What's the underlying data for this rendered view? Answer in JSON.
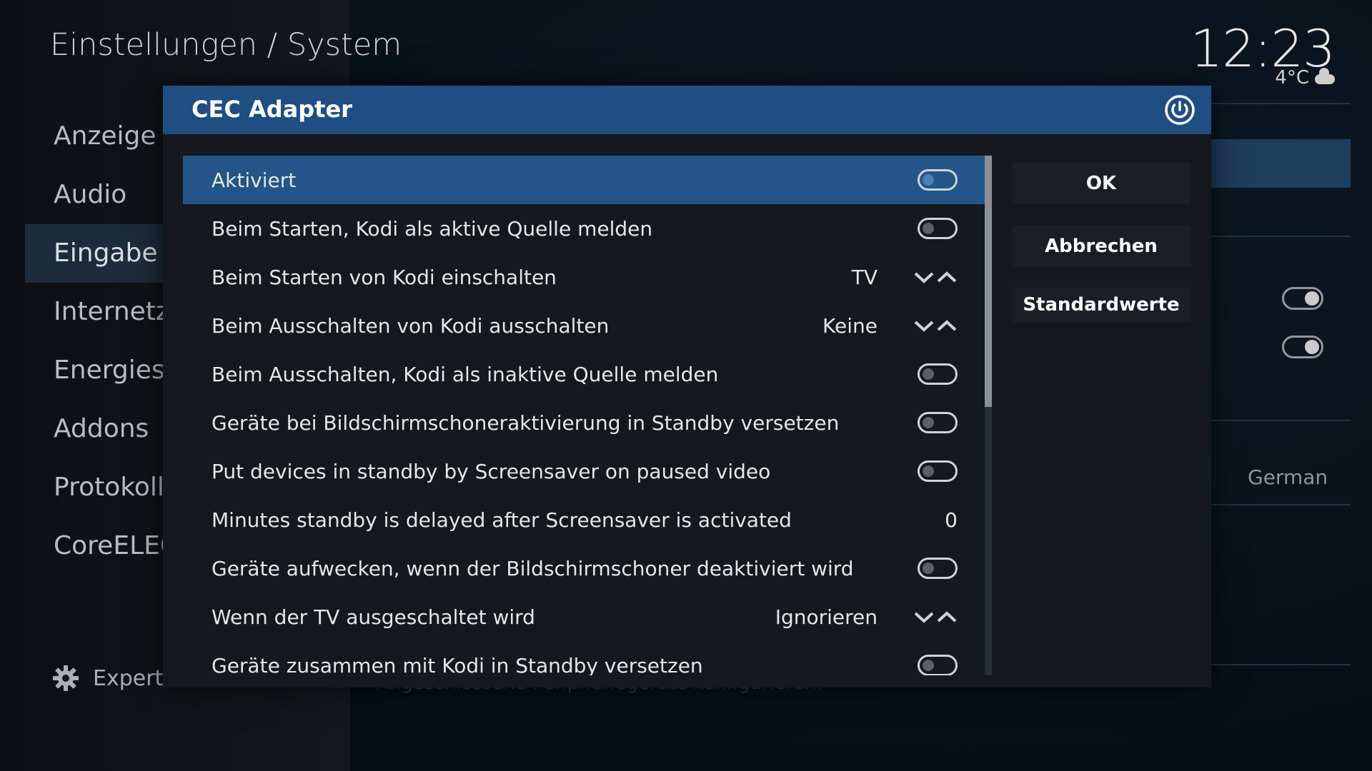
{
  "background": {
    "title": "Einstellungen / System",
    "clock": "12:23",
    "temperature": "4°C",
    "weather_icon": "cloud-icon",
    "nav": [
      {
        "label": "Anzeige"
      },
      {
        "label": "Audio"
      },
      {
        "label": "Eingabe",
        "active": true
      },
      {
        "label": "Internetzu"
      },
      {
        "label": "Energiesp"
      },
      {
        "label": "Addons"
      },
      {
        "label": "Protokolli"
      },
      {
        "label": "CoreELEC"
      }
    ],
    "expert_label": "Experte",
    "right_value": "German",
    "description": "Angeschlossene Peripheriegeräte konfigurieren."
  },
  "dialog": {
    "title": "CEC Adapter",
    "accent": "#1f4e80",
    "rows": [
      {
        "label": "Aktiviert",
        "control": "toggle"
      },
      {
        "label": "Beim Starten, Kodi als aktive Quelle melden",
        "control": "toggle"
      },
      {
        "label": "Beim Starten von Kodi einschalten",
        "control": "spinner",
        "value": "TV"
      },
      {
        "label": "Beim Ausschalten von Kodi ausschalten",
        "control": "spinner",
        "value": "Keine"
      },
      {
        "label": "Beim Ausschalten, Kodi als inaktive Quelle melden",
        "control": "toggle"
      },
      {
        "label": "Geräte bei Bildschirmschoneraktivierung in Standby versetzen",
        "control": "toggle"
      },
      {
        "label": "Put devices in standby by Screensaver on paused video",
        "control": "toggle"
      },
      {
        "label": "Minutes standby is delayed after Screensaver is activated",
        "control": "number",
        "value": "0"
      },
      {
        "label": "Geräte aufwecken, wenn der Bildschirmschoner deaktiviert wird",
        "control": "toggle"
      },
      {
        "label": "Wenn der TV ausgeschaltet wird",
        "control": "spinner",
        "value": "Ignorieren"
      },
      {
        "label": "Geräte zusammen mit Kodi in Standby versetzen",
        "control": "toggle"
      }
    ],
    "buttons": {
      "ok": "OK",
      "cancel": "Abbrechen",
      "defaults": "Standardwerte"
    }
  }
}
